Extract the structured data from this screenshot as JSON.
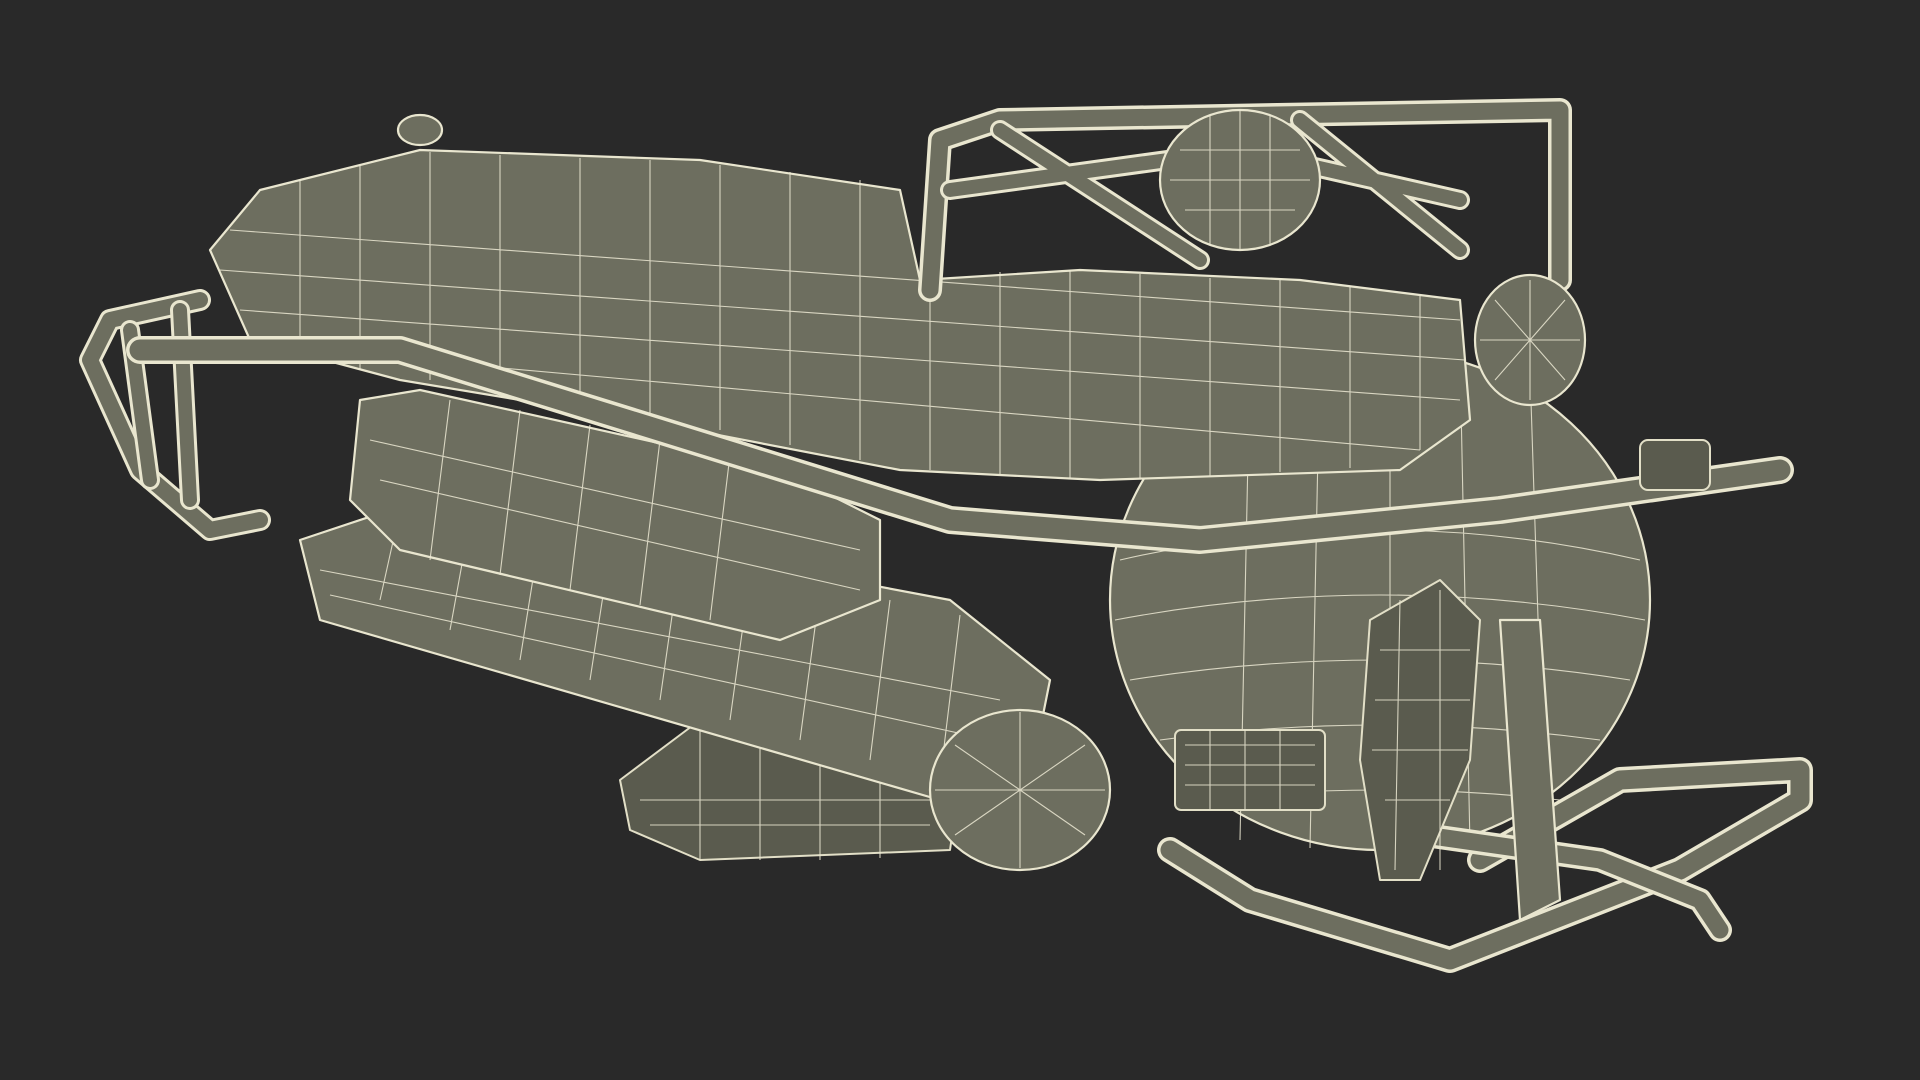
{
  "scene": {
    "subject": "submersible-wireframe-model",
    "colors": {
      "background": "#292929",
      "surface": "#6d6e5f",
      "surface_dark": "#5a5b4e",
      "wire": "#e9e6cf"
    }
  }
}
